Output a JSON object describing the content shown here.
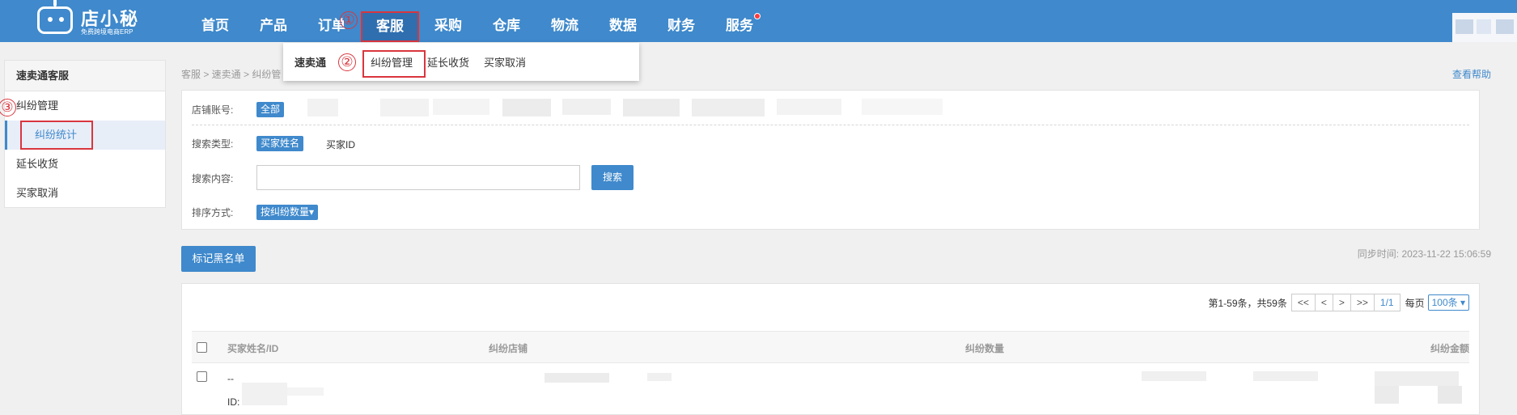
{
  "brand": {
    "name": "店小秘",
    "tagline": "免费跨境电商ERP"
  },
  "nav": {
    "items": [
      "首页",
      "产品",
      "订单",
      "客服",
      "采购",
      "仓库",
      "物流",
      "数据",
      "财务",
      "服务"
    ],
    "active": "客服"
  },
  "steps": [
    "①",
    "②",
    "③"
  ],
  "dropdown": {
    "items": [
      "速卖通",
      "纠纷管理",
      "延长收货",
      "买家取消"
    ]
  },
  "sidebar": {
    "title": "速卖通客服",
    "items": [
      "纠纷管理",
      "纠纷统计",
      "延长收货",
      "买家取消"
    ]
  },
  "breadcrumb": {
    "text": "客服 > 速卖通 > 纠纷管"
  },
  "help_link": "查看帮助",
  "filters": {
    "store_label": "店铺账号:",
    "store_all": "全部",
    "search_type_label": "搜索类型:",
    "search_type_selected": "买家姓名",
    "search_type_other": "买家ID",
    "search_content_label": "搜索内容:",
    "search_value": "",
    "search_button": "搜索",
    "sort_label": "排序方式:",
    "sort_value": "按纠纷数量▾"
  },
  "mark_blacklist_button": "标记黑名单",
  "sync_time": "同步时间: 2023-11-22 15:06:59",
  "pager": {
    "summary": "第1-59条，共59条",
    "first": "<<",
    "prev": "<",
    "next": ">",
    "last": ">>",
    "current": "1/1",
    "per_page_label": "每页",
    "per_page_value": "100条 ▾"
  },
  "table": {
    "headers": [
      "买家姓名/ID",
      "纠纷店铺",
      "纠纷数量",
      "纠纷金额"
    ],
    "rows": [
      {
        "name": "--",
        "id_label": "ID:"
      }
    ]
  }
}
